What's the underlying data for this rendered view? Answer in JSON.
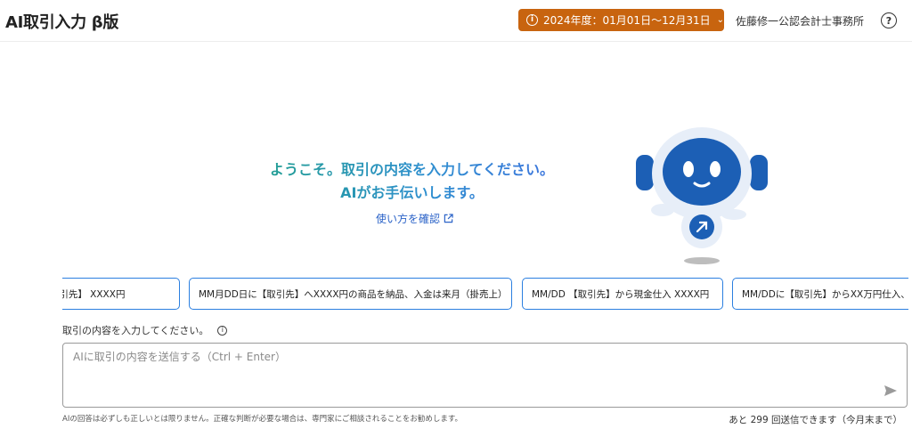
{
  "header": {
    "app_title": "AI取引入力 β版",
    "fiscal_year_label": "2024年度：01月01日〜12月31日",
    "office_name": "佐藤修一公認会計士事務所",
    "help_icon": "question-circle-icon"
  },
  "colors": {
    "accent_orange": "#c8640f",
    "link_blue": "#2b63c8",
    "chip_border": "#2b7fe0",
    "gradient_start": "#1fa08a",
    "gradient_end": "#3f6fe0",
    "robot_blue": "#1c5fb5"
  },
  "welcome": {
    "line1": "ようこそ。取引の内容を入力してください。",
    "line2": "AIがお手伝いします。",
    "usage_link": "使い方を確認"
  },
  "suggestions": [
    "売上 【取引先】 XXXX円",
    "MM月DD日に【取引先】へXXXX円の商品を納品、入金は来月（掛売上）",
    "MM/DD 【取引先】から現金仕入 XXXX円",
    "MM/DDに【取引先】からXX万円仕入、"
  ],
  "composer": {
    "label": "取引の内容を入力してください。",
    "placeholder": "AIに取引の内容を送信する（Ctrl + Enter）",
    "value": "",
    "disclaimer": "AIの回答は必ずしも正しいとは限りません。正確な判断が必要な場合は、専門家にご相談されることをお勧めします。",
    "remaining": "あと 299 回送信できます（今月末まで）"
  }
}
